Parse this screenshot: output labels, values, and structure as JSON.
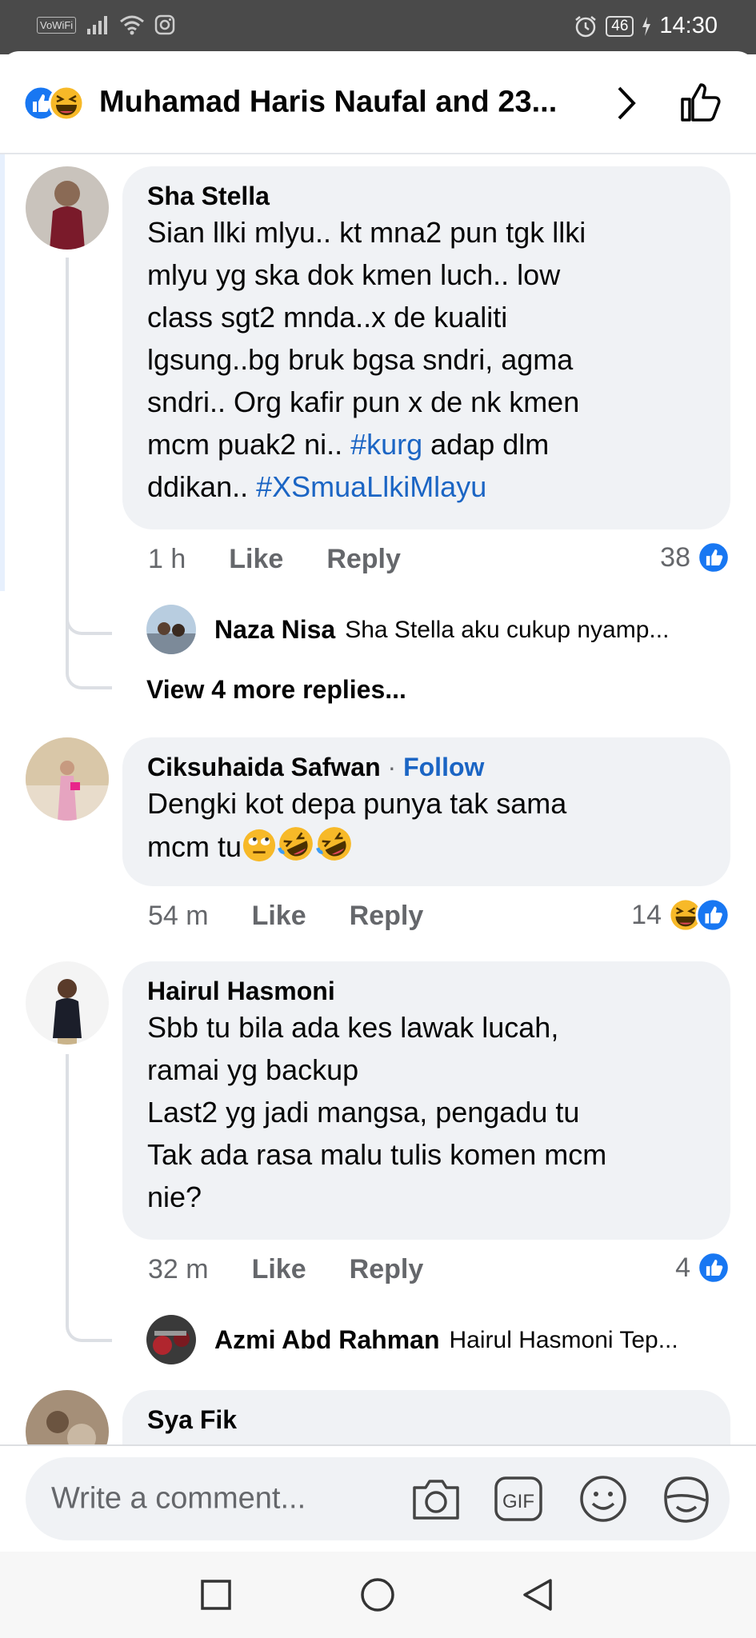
{
  "status_bar": {
    "network_label": "VoWiFi",
    "battery": "46",
    "time": "14:30"
  },
  "header": {
    "title": "Muhamad Haris Naufal and 23..."
  },
  "comments": [
    {
      "name": "Sha Stella",
      "text_lines": [
        "Sian llki mlyu.. kt mna2 pun tgk llki",
        "mlyu yg ska dok kmen luch.. low",
        "class sgt2 mnda..x de kualiti",
        "lgsung..bg bruk bgsa sndri, agma",
        "sndri.. Org kafir pun x de nk kmen",
        "mcm puak2 ni.. "
      ],
      "hashtag1": "#kurg",
      "after_hashtag1": " adap dlm",
      "line8_prefix": "ddikan..  ",
      "hashtag2": "#XSmuaLlkiMlayu",
      "time": "1 h",
      "like_label": "Like",
      "reply_label": "Reply",
      "reaction_count": "38",
      "reply_preview": {
        "name": "Naza Nisa",
        "text": "Sha Stella aku cukup nyamp..."
      },
      "view_more": "View 4 more replies..."
    },
    {
      "name": "Ciksuhaida Safwan",
      "follow_sep": " · ",
      "follow_label": "Follow",
      "text": "Dengki kot depa punya tak sama\nmcm tu",
      "time": "54 m",
      "like_label": "Like",
      "reply_label": "Reply",
      "reaction_count": "14"
    },
    {
      "name": "Hairul Hasmoni",
      "text": "Sbb tu bila ada kes lawak lucah,\nramai yg backup\nLast2 yg jadi mangsa, pengadu tu\nTak ada rasa malu tulis komen mcm\nnie?",
      "time": "32 m",
      "like_label": "Like",
      "reply_label": "Reply",
      "reaction_count": "4",
      "reply_preview": {
        "name": "Azmi Abd Rahman",
        "text": "Hairul Hasmoni Tep..."
      }
    },
    {
      "name": "Sya Fik"
    }
  ],
  "composer": {
    "placeholder": "Write a comment...",
    "icons": [
      "camera-icon",
      "gif-icon",
      "emoji-icon",
      "sticker-icon"
    ]
  },
  "nav_icons": [
    "recents-square-icon",
    "home-circle-icon",
    "back-triangle-icon"
  ],
  "colors": {
    "like_blue": "#1877f2",
    "link_blue": "#1b65c4",
    "bubble_gray": "#f0f2f5",
    "meta_gray": "#65676b",
    "haha_yellow": "#f7b928"
  }
}
